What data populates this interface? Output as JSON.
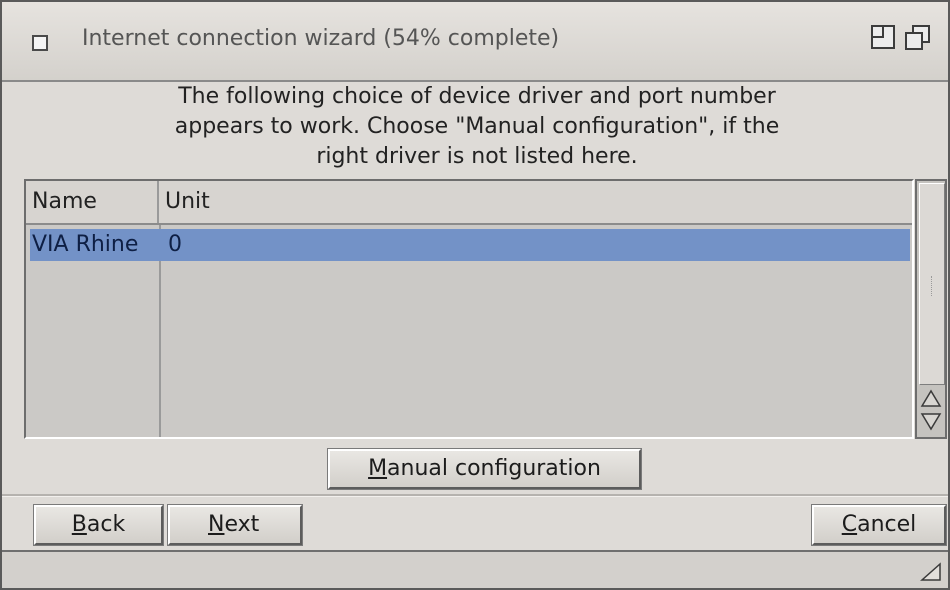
{
  "window": {
    "title": "Internet connection wizard (54% complete)",
    "progress_percent": 54
  },
  "instructions": {
    "line1": "The following choice of device driver and port number",
    "line2": "appears to work. Choose \"Manual configuration\", if the",
    "line3": "right driver is not listed here."
  },
  "list": {
    "columns": [
      "Name",
      "Unit"
    ],
    "rows": [
      {
        "name": "VIA Rhine",
        "unit": "0",
        "selected": true
      }
    ]
  },
  "buttons": {
    "manual_prefix": "M",
    "manual_rest": "anual configuration",
    "back_prefix": "B",
    "back_rest": "ack",
    "next_prefix": "N",
    "next_rest": "ext",
    "cancel_prefix": "C",
    "cancel_rest": "ancel"
  },
  "colors": {
    "selection": "#7392c7",
    "window_bg": "#dedbd7"
  },
  "icons": {
    "close": "close-box-icon",
    "zoom": "zoom-icon",
    "depth": "depth-icon",
    "scroll_up": "arrow-up-icon",
    "scroll_down": "arrow-down-icon",
    "resize": "resize-grip-icon"
  }
}
